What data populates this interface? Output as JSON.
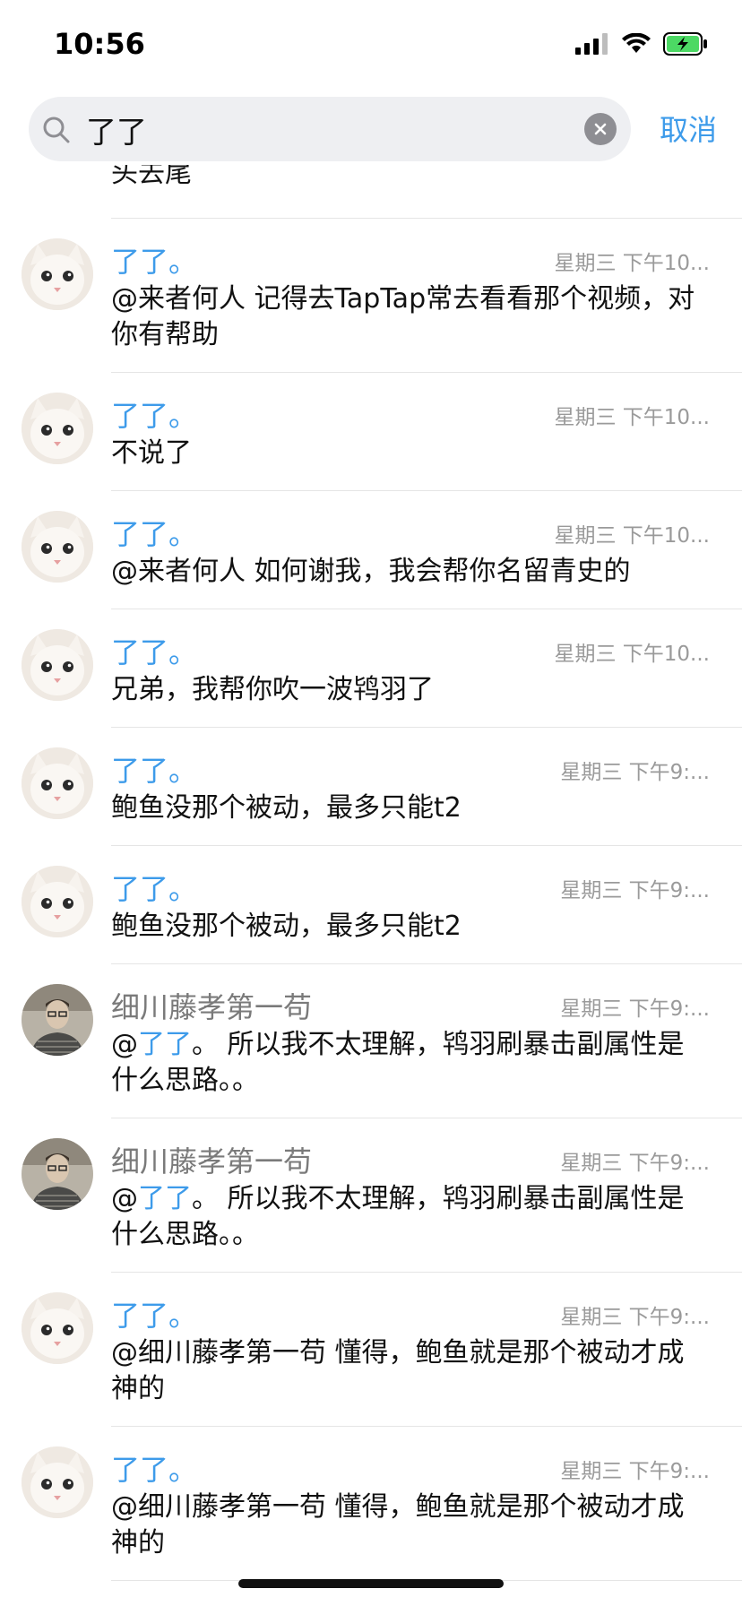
{
  "status_bar": {
    "time": "10:56"
  },
  "search": {
    "query": "了了",
    "cancel_label": "取消"
  },
  "partial_text": "头去尾",
  "messages": [
    {
      "sender": "了了。",
      "time": "星期三 下午10...",
      "text": "@来者何人 记得去TapTap常去看看那个视频，对你有帮助"
    },
    {
      "sender": "了了。",
      "time": "星期三 下午10...",
      "text": "不说了"
    },
    {
      "sender": "了了。",
      "time": "星期三 下午10...",
      "text": "@来者何人 如何谢我，我会帮你名留青史的"
    },
    {
      "sender": "了了。",
      "time": "星期三 下午10...",
      "text": "兄弟，我帮你吹一波鸨羽了"
    },
    {
      "sender": "了了。",
      "time": "星期三 下午9:...",
      "text": "鲍鱼没那个被动，最多只能t2"
    },
    {
      "sender": "了了。",
      "time": "星期三 下午9:...",
      "text": "鲍鱼没那个被动，最多只能t2"
    },
    {
      "sender": "细川藤孝第一苟",
      "time": "星期三 下午9:...",
      "mention": "了了",
      "text": "。 所以我不太理解，鸨羽刷暴击副属性是什么思路。。"
    },
    {
      "sender": "细川藤孝第一苟",
      "time": "星期三 下午9:...",
      "mention": "了了",
      "text": "。 所以我不太理解，鸨羽刷暴击副属性是什么思路。。"
    },
    {
      "sender": "了了。",
      "time": "星期三 下午9:...",
      "text": "@细川藤孝第一苟 懂得，鲍鱼就是那个被动才成神的"
    },
    {
      "sender": "了了。",
      "time": "星期三 下午9:...",
      "text": "@细川藤孝第一苟 懂得，鲍鱼就是那个被动才成神的"
    }
  ]
}
